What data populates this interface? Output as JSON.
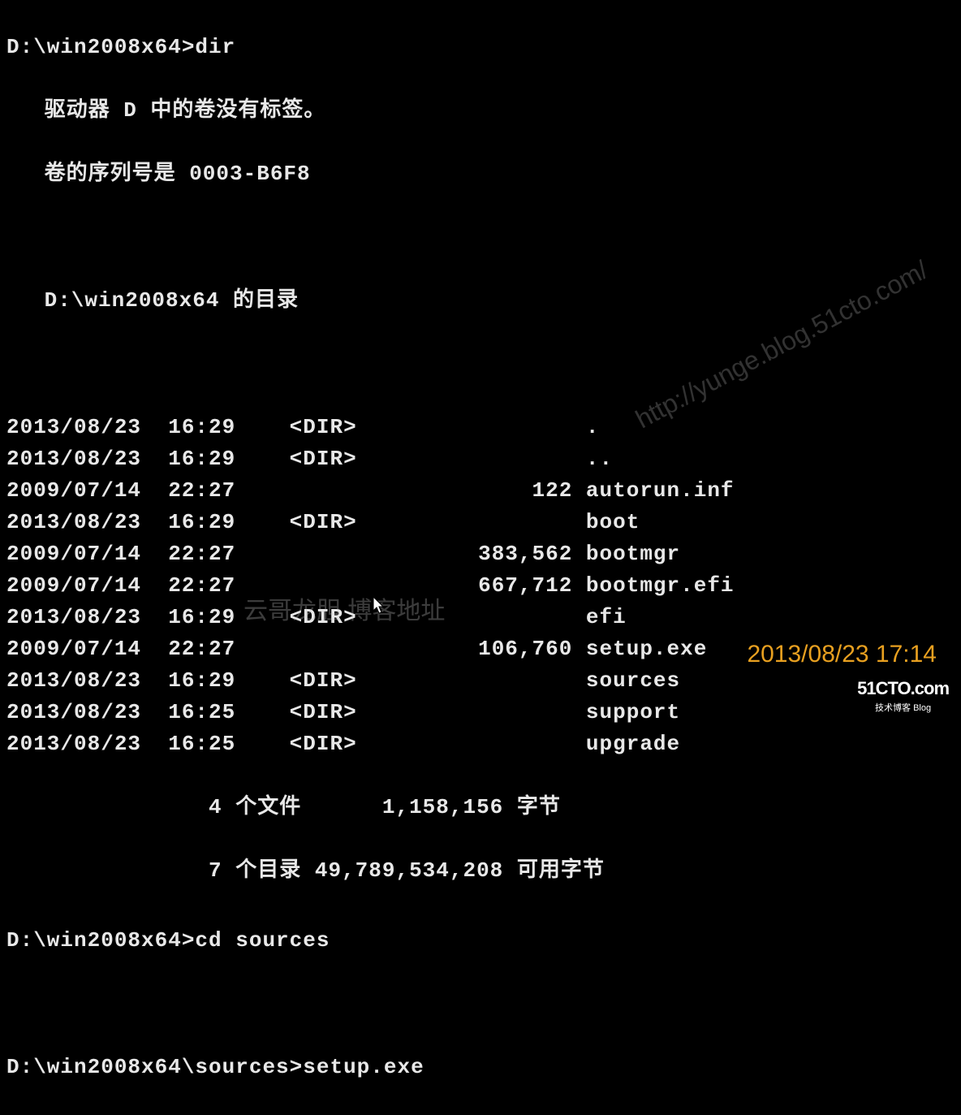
{
  "header": {
    "line0": "D:\\win2008x64>dir",
    "line1": " 驱动器 D 中的卷没有标签。",
    "line2": " 卷的序列号是 0003-B6F8",
    "line3": " D:\\win2008x64 的目录"
  },
  "dir_listing": [
    {
      "date": "2013/08/23",
      "time": "16:29",
      "type": "<DIR>",
      "size": "",
      "name": "."
    },
    {
      "date": "2013/08/23",
      "time": "16:29",
      "type": "<DIR>",
      "size": "",
      "name": ".."
    },
    {
      "date": "2009/07/14",
      "time": "22:27",
      "type": "",
      "size": "122",
      "name": "autorun.inf"
    },
    {
      "date": "2013/08/23",
      "time": "16:29",
      "type": "<DIR>",
      "size": "",
      "name": "boot"
    },
    {
      "date": "2009/07/14",
      "time": "22:27",
      "type": "",
      "size": "383,562",
      "name": "bootmgr"
    },
    {
      "date": "2009/07/14",
      "time": "22:27",
      "type": "",
      "size": "667,712",
      "name": "bootmgr.efi"
    },
    {
      "date": "2013/08/23",
      "time": "16:29",
      "type": "<DIR>",
      "size": "",
      "name": "efi"
    },
    {
      "date": "2009/07/14",
      "time": "22:27",
      "type": "",
      "size": "106,760",
      "name": "setup.exe"
    },
    {
      "date": "2013/08/23",
      "time": "16:29",
      "type": "<DIR>",
      "size": "",
      "name": "sources"
    },
    {
      "date": "2013/08/23",
      "time": "16:25",
      "type": "<DIR>",
      "size": "",
      "name": "support"
    },
    {
      "date": "2013/08/23",
      "time": "16:25",
      "type": "<DIR>",
      "size": "",
      "name": "upgrade"
    }
  ],
  "summary": {
    "files": "               4 个文件      1,158,156 字节",
    "dirs": "               7 个目录 49,789,534,208 可用字节"
  },
  "prompts": {
    "cd": "D:\\win2008x64>cd sources",
    "setup": "D:\\win2008x64\\sources>setup.exe"
  },
  "watermarks": {
    "url": "http://yunge.blog.51cto.com/",
    "center": "云哥龙胆 博客地址"
  },
  "timestamp": "2013/08/23 17:14",
  "logo": {
    "main": "51CTO.com",
    "sub": "技术博客   Blog"
  }
}
